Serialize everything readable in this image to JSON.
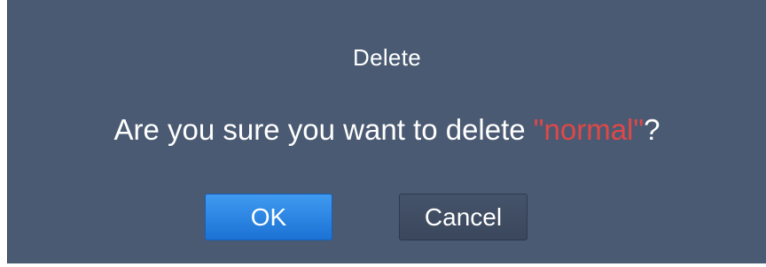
{
  "dialog": {
    "title": "Delete",
    "message_prefix": "Are you sure you want to delete ",
    "message_item": "\"normal\"",
    "message_suffix": "?",
    "ok_label": "OK",
    "cancel_label": "Cancel"
  },
  "colors": {
    "background": "#4a5a72",
    "highlight": "#e04848",
    "ok_button": "#2a84e4",
    "cancel_button": "#3f4d63"
  }
}
